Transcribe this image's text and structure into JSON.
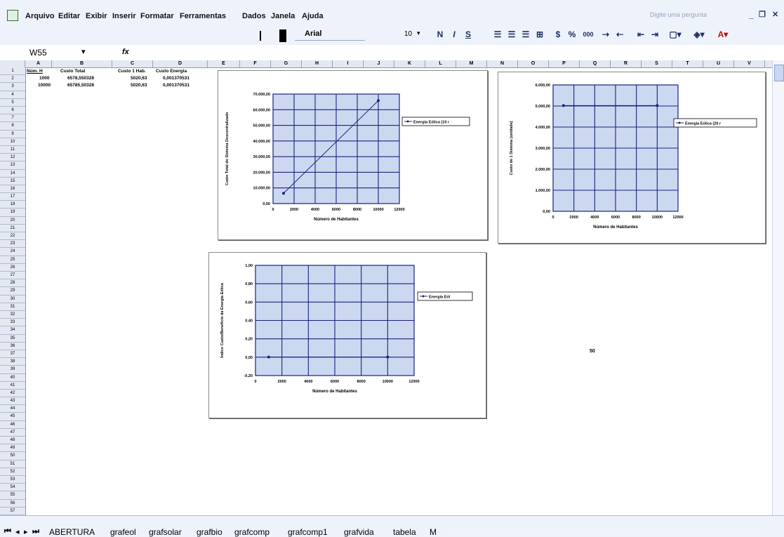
{
  "menu": [
    "Arquivo",
    "Editar",
    "Exibir",
    "Inserir",
    "Formatar",
    "Ferramentas",
    "Dados",
    "Janela",
    "Ajuda"
  ],
  "toolbar": {
    "font_name": "Arial",
    "font_size": "10",
    "bold": "N",
    "italic": "I",
    "underline": "S",
    "percent": "%",
    "thousands": "000"
  },
  "help_box_placeholder": "Digite uma pergunta",
  "formula": {
    "cell_ref": "W55",
    "fx": "fx"
  },
  "columns": [
    "A",
    "B",
    "C",
    "D",
    "E",
    "F",
    "G",
    "H",
    "I",
    "J",
    "K",
    "L",
    "M",
    "N",
    "O",
    "P",
    "Q",
    "R",
    "S",
    "T",
    "U",
    "V"
  ],
  "rows": [
    "1",
    "2",
    "3",
    "4",
    "5",
    "6",
    "7",
    "8",
    "9",
    "10",
    "11",
    "12",
    "13",
    "14",
    "15",
    "16",
    "17",
    "18",
    "19",
    "20",
    "21",
    "22",
    "23",
    "24",
    "25",
    "26",
    "27",
    "28",
    "29",
    "30",
    "31",
    "32",
    "33",
    "34",
    "35",
    "36",
    "37",
    "38",
    "39",
    "40",
    "41",
    "42",
    "43",
    "44",
    "45",
    "46",
    "47",
    "48",
    "49",
    "50",
    "51",
    "52",
    "53",
    "54",
    "55",
    "56",
    "57"
  ],
  "table": {
    "headers": [
      "Núm. H",
      "Custo Total",
      "Custo 1 Hab.",
      "Custo Energia"
    ],
    "rows": [
      [
        "1000",
        "6578,550328",
        "5020,63",
        "0,001370531"
      ],
      [
        "10000",
        "65785,50328",
        "5020,63",
        "0,001370531"
      ]
    ]
  },
  "stray_text": "50",
  "tabs": [
    "ABERTURA",
    "grafeol",
    "grafsolar",
    "grafbio",
    "grafcomp",
    "grafcomp1",
    "grafvida",
    "tabela",
    "M"
  ],
  "chart_data": [
    {
      "type": "line",
      "ylabel": "Custo Total do Sistema Descentralizado",
      "xlabel": "Número de Habitantes",
      "ylim": [
        0,
        70000
      ],
      "yticks": [
        "0,00",
        "10.000,00",
        "20.000,00",
        "30.000,00",
        "40.000,00",
        "50.000,00",
        "60.000,00",
        "70.000,00"
      ],
      "xticks": [
        "0",
        "2000",
        "4000",
        "6000",
        "8000",
        "10000",
        "12000"
      ],
      "series": [
        {
          "name": "Energia Eólica (10 r",
          "x": [
            1000,
            10000
          ],
          "y": [
            6578.55,
            65785.5
          ]
        }
      ],
      "legend": "right",
      "grid": true
    },
    {
      "type": "line",
      "ylabel": "Custo de 1 Sistema (unidade)",
      "xlabel": "Número de Habitantes",
      "ylim": [
        0,
        6000
      ],
      "yticks": [
        "0,00",
        "1.000,00",
        "2.000,00",
        "3.000,00",
        "4.000,00",
        "5.000,00",
        "6.000,00"
      ],
      "xticks": [
        "0",
        "2000",
        "4000",
        "6000",
        "8000",
        "10000",
        "12000"
      ],
      "series": [
        {
          "name": "Energia Eólica (20 r",
          "x": [
            1000,
            10000
          ],
          "y": [
            5020.63,
            5020.63
          ]
        }
      ],
      "legend": "right",
      "grid": true
    },
    {
      "type": "line",
      "ylabel": "Índice Custo/Benefício da Energia Eólica",
      "xlabel": "Número de Habitantes",
      "ylim": [
        -0.2,
        1.0
      ],
      "yticks": [
        "-0,20",
        "0,00",
        "0,20",
        "0,40",
        "0,60",
        "0,80",
        "1,00"
      ],
      "xticks": [
        "0",
        "2000",
        "4000",
        "6000",
        "8000",
        "10000",
        "12000"
      ],
      "series": [
        {
          "name": "Energia Eól",
          "x": [
            1000,
            10000
          ],
          "y": [
            0.00137,
            0.00137
          ]
        }
      ],
      "legend": "right",
      "grid": true
    }
  ]
}
